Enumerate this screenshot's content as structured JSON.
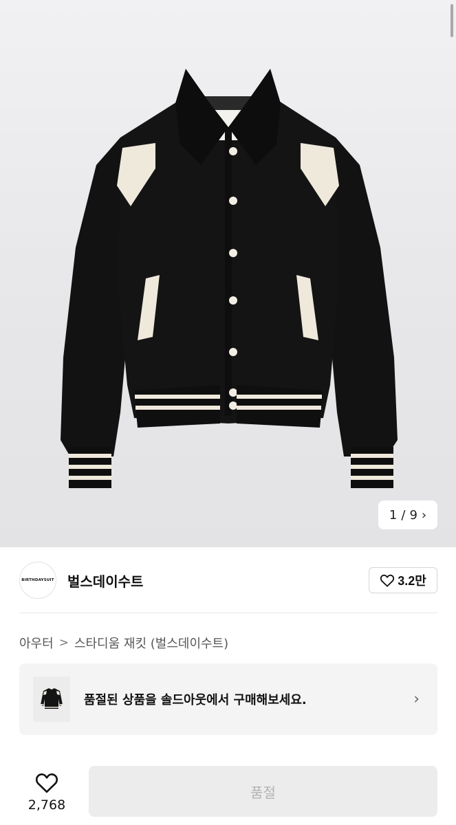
{
  "gallery": {
    "current": "1",
    "divider": "/",
    "total": "9",
    "next_icon": "chevron-right-icon"
  },
  "brand": {
    "logo_text": "BIRTHDAYSUIT",
    "name": "벌스데이수트",
    "like_icon": "heart-outline-icon",
    "like_count": "3.2만"
  },
  "breadcrumb": {
    "category": "아우터",
    "separator": ">",
    "product": "스타디움 재킷 (벌스데이수트)"
  },
  "soldout_banner": {
    "text": "품절된 상품을 솔드아웃에서 구매해보세요.",
    "chevron": "›"
  },
  "bottom_bar": {
    "like_icon": "heart-outline-icon",
    "like_count": "2,768",
    "buy_label": "품절"
  },
  "colors": {
    "hero_bg": "#e7e7e9",
    "jacket": "#111111",
    "accent_cream": "#efe9dc",
    "disabled_button_bg": "#ececec",
    "disabled_button_text": "#b3b3b3"
  }
}
